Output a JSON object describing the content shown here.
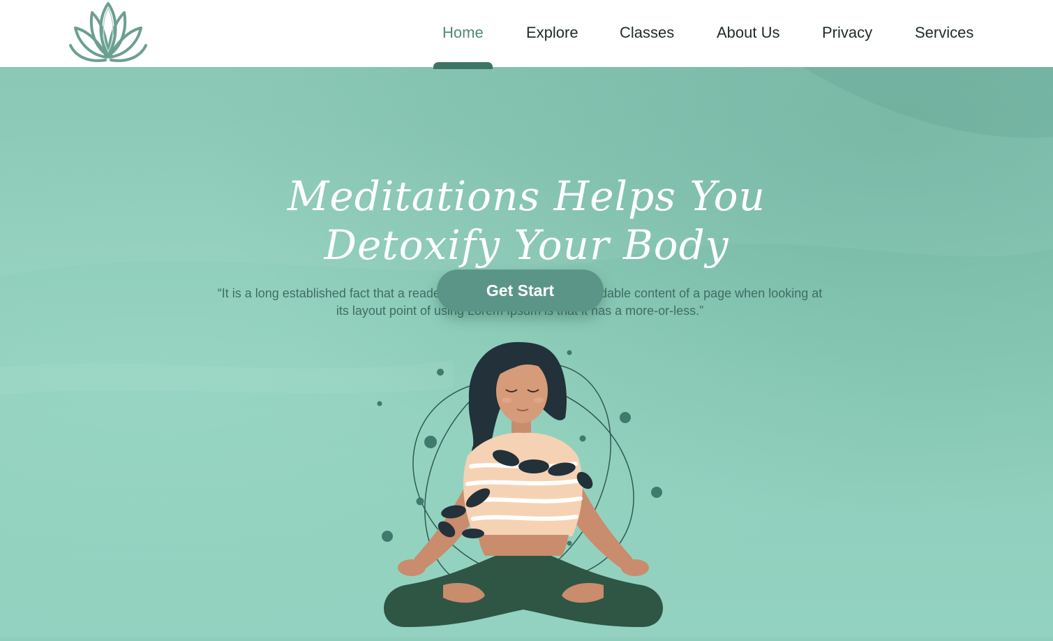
{
  "header": {
    "logo": {
      "icon": "lotus-icon",
      "color": "#6a9e90"
    },
    "nav": [
      {
        "label": "Home",
        "active": true
      },
      {
        "label": "Explore",
        "active": false
      },
      {
        "label": "Classes",
        "active": false
      },
      {
        "label": "About Us",
        "active": false
      },
      {
        "label": "Privacy",
        "active": false
      },
      {
        "label": "Services",
        "active": false
      }
    ]
  },
  "hero": {
    "title_line1": "Meditations Helps You",
    "title_line2": "Detoxify Your Body",
    "quote": "“It is a long established fact that a reader will be distracted by the readable content of a page when looking at its layout point of using Lorem Ipsum is that it has a more-or-less.”",
    "cta_label": "Get Start",
    "illustration": "meditating-woman-illustration"
  },
  "colors": {
    "background": "#8ecdbb",
    "accent": "#5b9587",
    "nav_active": "#4f8a7a",
    "indicator": "#3c7466"
  }
}
